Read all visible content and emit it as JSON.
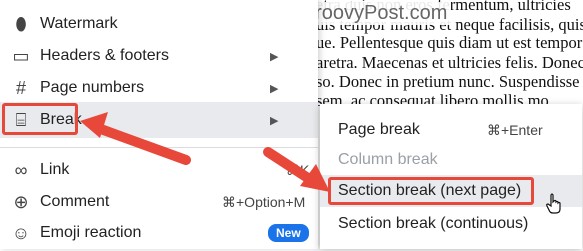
{
  "document": {
    "watermark": "groovyPost.com",
    "lines": [
      "etra quis non eros fermentum, ultricies",
      "uis tempor mauris et neque facilisis, quis",
      "ue. Pellentesque quis diam ut est tempor",
      "aretra. Maecenas et ultricies felis. Donec",
      "so. Donec in pretium nunc. Suspendisse",
      "sem, ac consequat libero mollis mo"
    ]
  },
  "menu": {
    "items": [
      {
        "label": "Watermark",
        "icon": "watermark-icon",
        "glyph": "⬮"
      },
      {
        "label": "Headers & footers",
        "icon": "header-footer-icon",
        "glyph": "▭",
        "submenu": true
      },
      {
        "label": "Page numbers",
        "icon": "hash-icon",
        "glyph": "#",
        "submenu": true
      },
      {
        "label": "Break",
        "icon": "page-break-icon",
        "glyph": "⌸",
        "submenu": true,
        "highlighted": true
      },
      {
        "label": "Link",
        "icon": "link-icon",
        "glyph": "∞",
        "shortcut": "⌘K"
      },
      {
        "label": "Comment",
        "icon": "comment-icon",
        "glyph": "⊕",
        "shortcut": "⌘+Option+M"
      },
      {
        "label": "Emoji reaction",
        "icon": "emoji-icon",
        "glyph": "☺",
        "badge": "New"
      }
    ],
    "submenu_arrow": "▶"
  },
  "break_submenu": {
    "items": [
      {
        "label": "Page break",
        "shortcut": "⌘+Enter",
        "disabled": false
      },
      {
        "label": "Column break",
        "shortcut": "",
        "disabled": true
      },
      {
        "label": "Section break (next page)",
        "shortcut": "",
        "disabled": false,
        "highlighted": true
      },
      {
        "label": "Section break (continuous)",
        "shortcut": "",
        "disabled": false
      }
    ]
  },
  "colors": {
    "annotation": "#e8483a",
    "highlight": "#e8eaed",
    "badge": "#1a73e8"
  }
}
